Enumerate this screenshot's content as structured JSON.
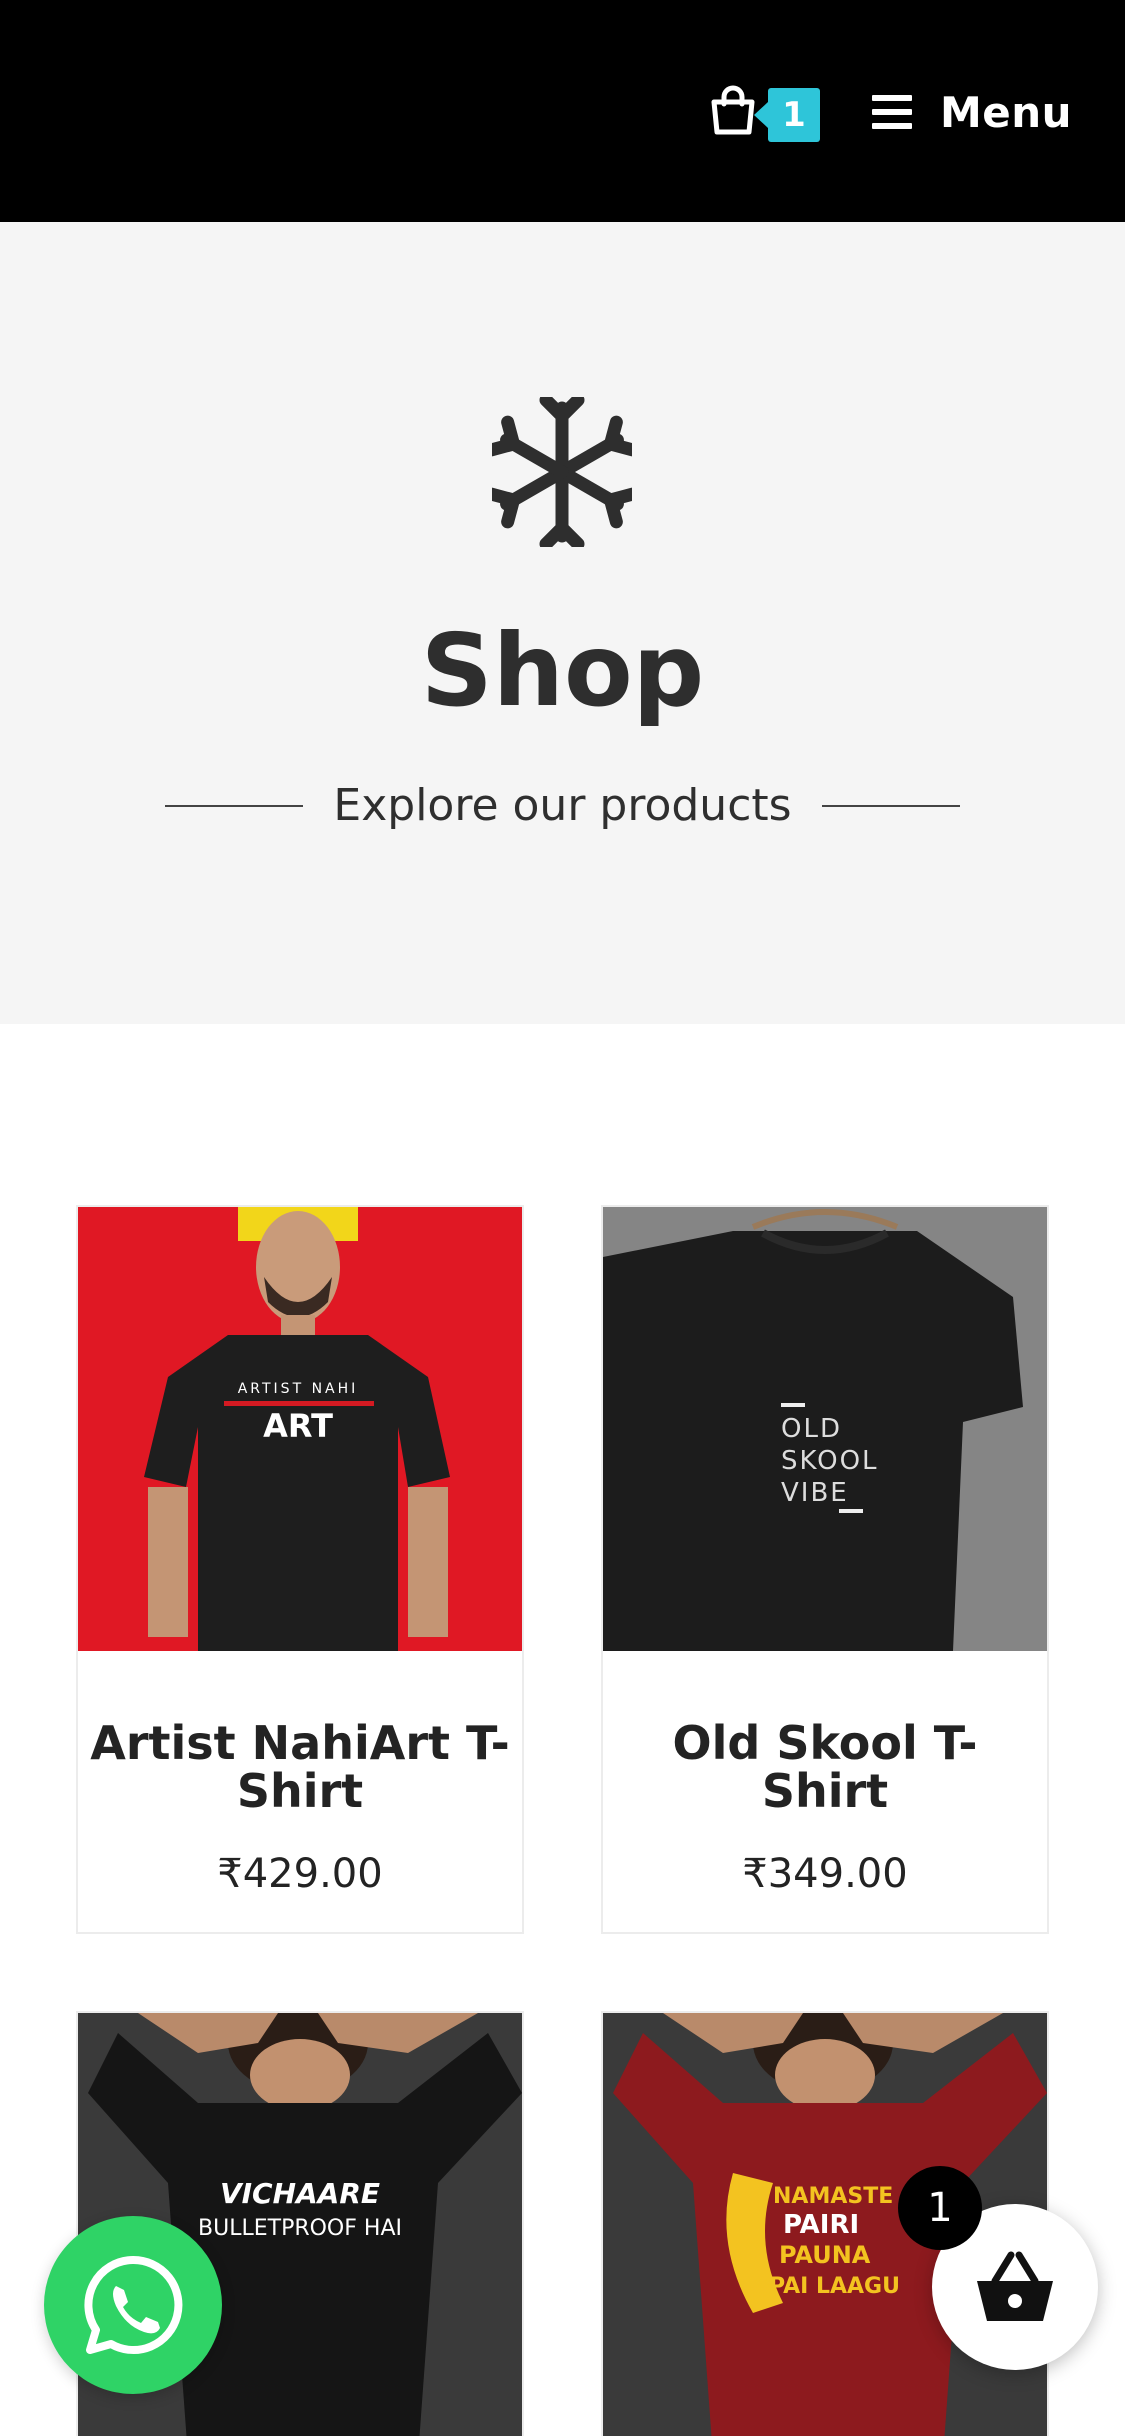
{
  "header": {
    "cart_count": "1",
    "menu_label": "Menu",
    "accent_color": "#2ec5d9"
  },
  "hero": {
    "icon": "snowflake-icon",
    "title": "Shop",
    "subtitle": "Explore our products"
  },
  "products": [
    {
      "name_line1": "Artist NahiArt T-",
      "name_line2": "Shirt",
      "price": "₹429.00",
      "shirt_text_1": "ARTIST NAHI",
      "shirt_text_2": "ART"
    },
    {
      "name_line1": "Old Skool T-Shirt",
      "name_line2": "",
      "price": "₹349.00",
      "shirt_text_1": "OLD",
      "shirt_text_2": "SKOOL",
      "shirt_text_3": "VIBE"
    },
    {
      "shirt_text_1": "VICHAARE",
      "shirt_text_2": "BULLETPROOF HAI"
    },
    {
      "shirt_text_1": "NAMASTE",
      "shirt_text_2": "PAIRI",
      "shirt_text_3": "PAUNA",
      "shirt_text_4": "PAI LAAGU"
    }
  ],
  "floating": {
    "whatsapp_icon": "whatsapp-icon",
    "basket_icon": "basket-icon",
    "basket_count": "1",
    "whatsapp_color": "#2fd366"
  }
}
